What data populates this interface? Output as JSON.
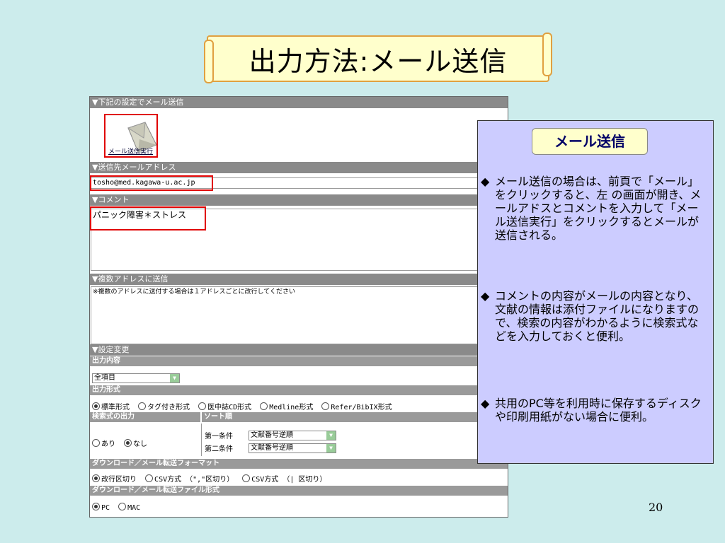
{
  "slide": {
    "title": "出力方法:メール送信",
    "number": "20"
  },
  "panel": {
    "sec_send": "▼下記の設定でメール送信",
    "send_button_label": "メール送信実行",
    "sec_address": "▼送信先メールアドレス",
    "address_value": "tosho@med.kagawa-u.ac.jp",
    "sec_comment": "▼コメント",
    "comment_value": "パニック障害＊ストレス",
    "sec_multi": "▼複数アドレスに送信",
    "multi_note": "※複数のアドレスに送付する場合は１アドレスごとに改行してください",
    "sec_settings": "▼設定変更",
    "output_content_label": "出力内容",
    "output_content_value": "全項目",
    "output_format_label": "出力形式",
    "formats": [
      "標準形式",
      "タグ付き形式",
      "医中誌CD形式",
      "Medline形式",
      "Refer/BibIX形式"
    ],
    "format_selected": 0,
    "search_output_label": "検索式の出力",
    "sort_label": "ソート順",
    "search_output_options": [
      "あり",
      "なし"
    ],
    "search_output_selected": 1,
    "sort1_label": "第一条件",
    "sort1_value": "文献番号逆順",
    "sort2_label": "第二条件",
    "sort2_value": "文献番号逆順",
    "download_format_label": "ダウンロード／メール転送フォーマット",
    "download_formats": [
      "改行区切り",
      "CSV方式 （\",\"区切り）",
      "CSV方式 （| 区切り）"
    ],
    "download_format_selected": 0,
    "download_file_label": "ダウンロード／メール転送ファイル形式",
    "file_formats": [
      "PC",
      "MAC"
    ],
    "file_format_selected": 0
  },
  "info": {
    "heading": "メール送信",
    "bullet": "◆",
    "para1": "メール送信の場合は、前頁で「メール」をクリックすると、左 の画面が開き、メールアドスとコメントを入力して「メール送信実行」をクリックするとメールが送信される。",
    "para2": "コメントの内容がメールの内容となり、文献の情報は添付ファイルになりますので、検索の内容がわかるように検索式などを入力しておくと便利。",
    "para3": "共用のPC等を利用時に保存するディスクや印刷用紙がない場合に便利。"
  }
}
